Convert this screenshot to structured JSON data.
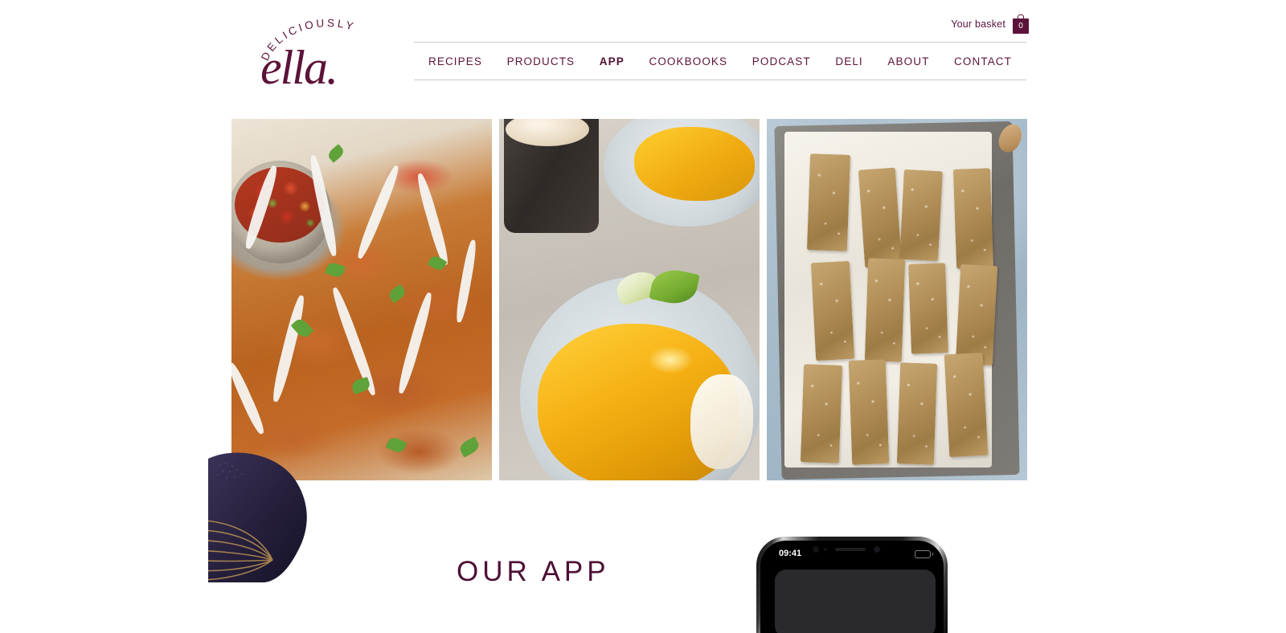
{
  "site": {
    "brand_color": "#5c1339",
    "logo": {
      "arc_text": "DELICIOUSLY",
      "script_text": "ella.",
      "name": "Deliciously Ella"
    }
  },
  "header": {
    "basket": {
      "label": "Your basket",
      "count": "0",
      "icon": "basket-icon"
    },
    "nav": {
      "items": [
        {
          "label": "RECIPES",
          "active": false
        },
        {
          "label": "PRODUCTS",
          "active": false
        },
        {
          "label": "APP",
          "active": true
        },
        {
          "label": "COOKBOOKS",
          "active": false
        },
        {
          "label": "PODCAST",
          "active": false
        },
        {
          "label": "DELI",
          "active": false
        },
        {
          "label": "ABOUT",
          "active": false
        },
        {
          "label": "CONTACT",
          "active": false
        }
      ]
    }
  },
  "hero": {
    "images": [
      {
        "alt": "Sweet potato fritters with yoghurt drizzle and tomato salad"
      },
      {
        "alt": "Turmeric crepes with lime and syrup"
      },
      {
        "alt": "Oat and almond energy bars on a baking tray"
      }
    ]
  },
  "our_app": {
    "title": "OUR APP",
    "phone": {
      "status_time": "09:41",
      "battery_color": "#4cd964"
    }
  },
  "decor": {
    "blob": {
      "name": "whisk-blob-decoration",
      "fill_color": "#2e2746",
      "line_color": "#b08a52"
    }
  }
}
